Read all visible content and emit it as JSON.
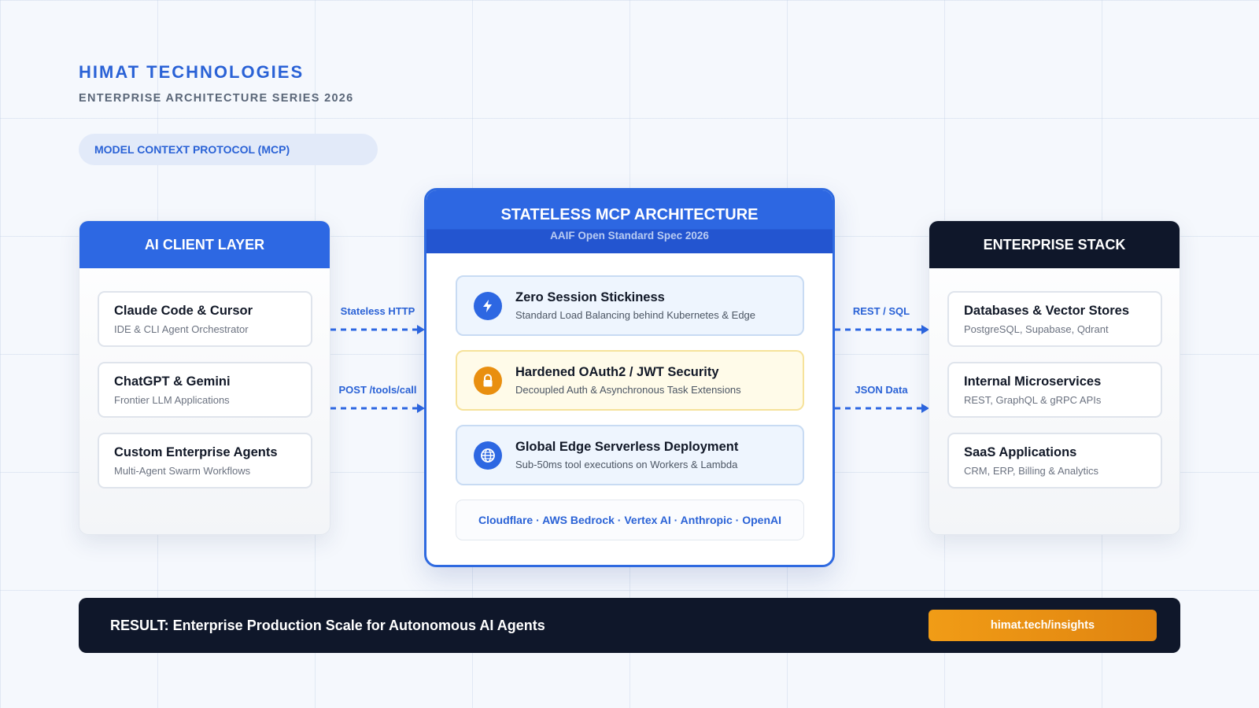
{
  "header": {
    "brand": "HIMAT TECHNOLOGIES",
    "series": "ENTERPRISE ARCHITECTURE SERIES 2026",
    "pill": "MODEL CONTEXT PROTOCOL (MCP)"
  },
  "client_layer": {
    "title": "AI CLIENT LAYER",
    "items": [
      {
        "title": "Claude Code & Cursor",
        "subtitle": "IDE & CLI Agent Orchestrator"
      },
      {
        "title": "ChatGPT & Gemini",
        "subtitle": "Frontier LLM Applications"
      },
      {
        "title": "Custom Enterprise Agents",
        "subtitle": "Multi-Agent Swarm Workflows"
      }
    ]
  },
  "left_connectors": [
    "Stateless HTTP",
    "POST /tools/call"
  ],
  "architecture": {
    "title": "STATELESS MCP ARCHITECTURE",
    "subtitle": "AAIF Open Standard Spec 2026",
    "features": [
      {
        "icon": "lightning-icon",
        "title": "Zero Session Stickiness",
        "subtitle": "Standard Load Balancing behind Kubernetes & Edge"
      },
      {
        "icon": "lock-icon",
        "title": "Hardened OAuth2 / JWT Security",
        "subtitle": "Decoupled Auth & Asynchronous Task Extensions"
      },
      {
        "icon": "globe-icon",
        "title": "Global Edge Serverless Deployment",
        "subtitle": "Sub-50ms tool executions on Workers & Lambda"
      }
    ],
    "vendors": "Cloudflare · AWS Bedrock · Vertex AI · Anthropic · OpenAI"
  },
  "right_connectors": [
    "REST / SQL",
    "JSON Data"
  ],
  "enterprise_stack": {
    "title": "ENTERPRISE STACK",
    "items": [
      {
        "title": "Databases & Vector Stores",
        "subtitle": "PostgreSQL, Supabase, Qdrant"
      },
      {
        "title": "Internal Microservices",
        "subtitle": "REST, GraphQL & gRPC APIs"
      },
      {
        "title": "SaaS Applications",
        "subtitle": "CRM, ERP, Billing & Analytics"
      }
    ]
  },
  "footer": {
    "result": "RESULT: Enterprise Production Scale for Autonomous AI Agents",
    "link": "himat.tech/insights"
  },
  "colors": {
    "accent": "#2d67e2",
    "dark": "#0f172a",
    "orange": "#e98f10"
  }
}
